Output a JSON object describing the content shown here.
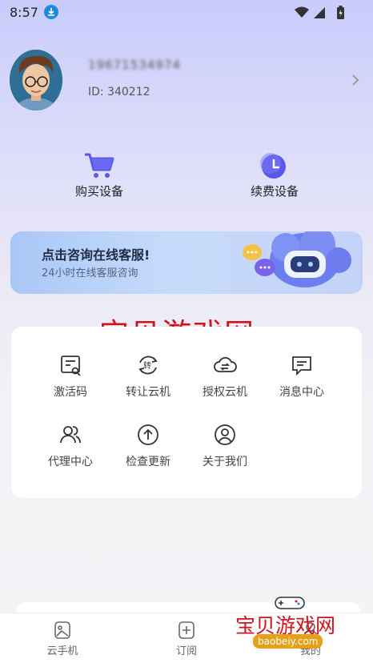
{
  "status_bar": {
    "time": "8:57"
  },
  "profile": {
    "username": "19671534974",
    "user_id": "ID: 340212"
  },
  "quick_actions": [
    {
      "label": "购买设备",
      "icon": "cart-icon"
    },
    {
      "label": "续费设备",
      "icon": "clock-icon"
    }
  ],
  "service_banner": {
    "title": "点击咨询在线客服!",
    "subtitle": "24小时在线客服咨询"
  },
  "watermark": {
    "text": "宝贝游戏网",
    "url": "baobeiy.com"
  },
  "features": [
    {
      "label": "激活码",
      "icon": "activation-code-icon"
    },
    {
      "label": "转让云机",
      "icon": "transfer-icon"
    },
    {
      "label": "授权云机",
      "icon": "cloud-authorize-icon"
    },
    {
      "label": "消息中心",
      "icon": "message-icon"
    },
    {
      "label": "代理中心",
      "icon": "agent-icon"
    },
    {
      "label": "检查更新",
      "icon": "update-icon"
    },
    {
      "label": "关于我们",
      "icon": "about-icon"
    }
  ],
  "tabs": [
    {
      "label": "云手机",
      "icon": "cloud-phone-icon"
    },
    {
      "label": "订阅",
      "icon": "subscribe-icon"
    },
    {
      "label": "我的",
      "icon": "profile-icon"
    }
  ],
  "colors": {
    "accent": "#5a58e8",
    "watermark": "#d4121b",
    "banner": "#b7d0f8"
  }
}
